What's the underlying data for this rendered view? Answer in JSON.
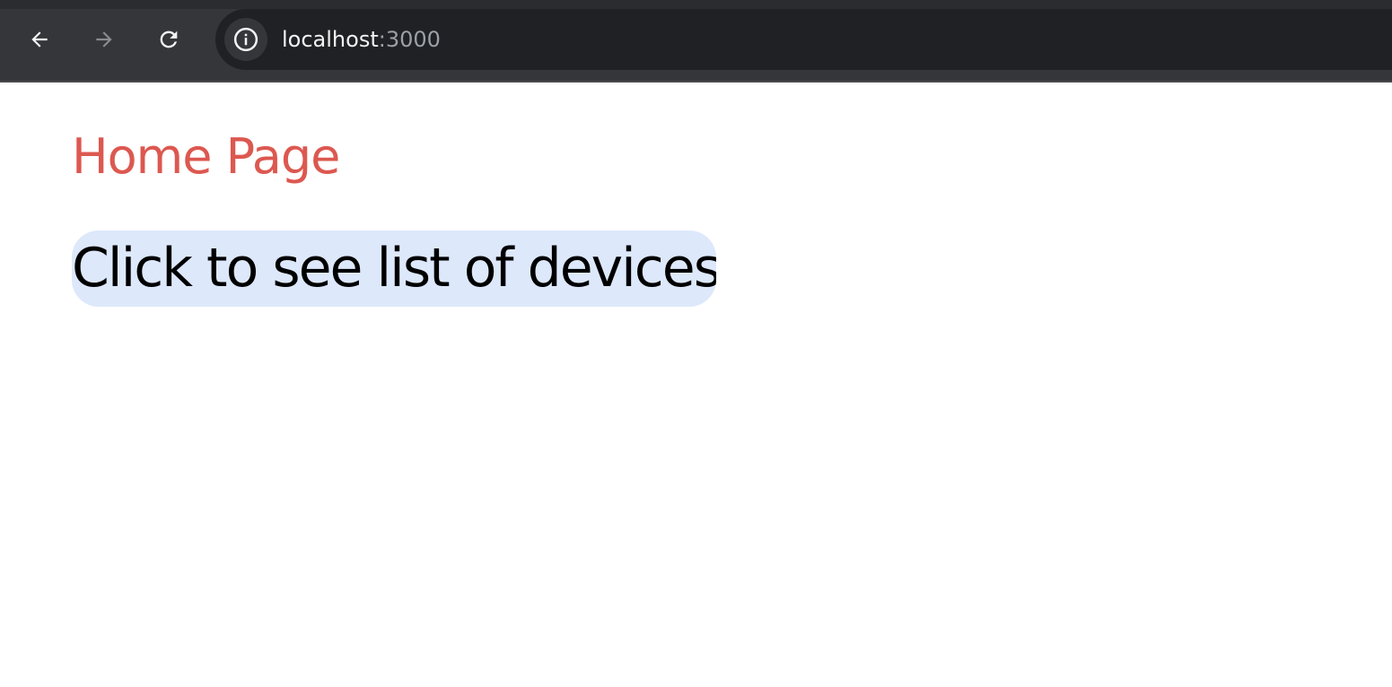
{
  "browser": {
    "url_host": "localhost",
    "url_port": ":3000",
    "icons": {
      "back": "arrow-left-icon",
      "forward": "arrow-right-icon",
      "reload": "reload-icon",
      "site_info": "info-icon"
    }
  },
  "page": {
    "title": "Home Page",
    "button_label": "Click to see list of devices"
  },
  "colors": {
    "title": "#dc5850",
    "button_bg": "#dde8fb",
    "toolbar_bg": "#35363a",
    "address_bar_bg": "#202124"
  }
}
